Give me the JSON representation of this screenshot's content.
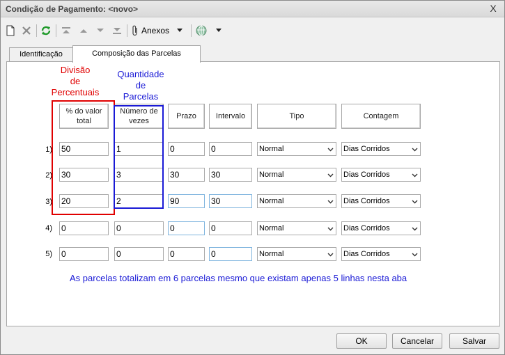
{
  "window": {
    "title": "Condição de Pagamento: <novo>",
    "close_glyph": "X"
  },
  "toolbar": {
    "items": [
      "new-icon",
      "delete-icon",
      "refresh-icon",
      "first-icon",
      "prev-icon",
      "next-icon",
      "last-icon",
      "paperclip-icon",
      "globe-icon"
    ],
    "anexos_label": "Anexos"
  },
  "tabs": [
    {
      "label": "Identificação",
      "active": false
    },
    {
      "label": "Composição das Parcelas",
      "active": true
    }
  ],
  "annotations": {
    "red_label": [
      "Divisão",
      "de",
      "Percentuais"
    ],
    "blue_label": [
      "Quantidade",
      "de",
      "Parcelas"
    ],
    "note": "As parcelas totalizam em 6 parcelas mesmo que existam apenas 5 linhas nesta aba"
  },
  "headers": {
    "percent": [
      "% do valor",
      "total"
    ],
    "count": [
      "Número de",
      "vezes"
    ],
    "prazo": "Prazo",
    "intervalo": "Intervalo",
    "tipo": "Tipo",
    "contagem": "Contagem"
  },
  "rows": [
    {
      "num": "1)",
      "percent": "50",
      "count": "1",
      "prazo": "0",
      "intervalo": "0",
      "tipo": "Normal",
      "contagem": "Dias Corridos"
    },
    {
      "num": "2)",
      "percent": "30",
      "count": "3",
      "prazo": "30",
      "intervalo": "30",
      "tipo": "Normal",
      "contagem": "Dias Corridos"
    },
    {
      "num": "3)",
      "percent": "20",
      "count": "2",
      "prazo": "90",
      "intervalo": "30",
      "tipo": "Normal",
      "contagem": "Dias Corridos"
    },
    {
      "num": "4)",
      "percent": "0",
      "count": "0",
      "prazo": "0",
      "intervalo": "0",
      "tipo": "Normal",
      "contagem": "Dias Corridos"
    },
    {
      "num": "5)",
      "percent": "0",
      "count": "0",
      "prazo": "0",
      "intervalo": "0",
      "tipo": "Normal",
      "contagem": "Dias Corridos"
    }
  ],
  "buttons": {
    "ok": "OK",
    "cancel": "Cancelar",
    "save": "Salvar"
  },
  "colors": {
    "annotation_red": "#e00000",
    "annotation_blue": "#1a1ad6"
  }
}
